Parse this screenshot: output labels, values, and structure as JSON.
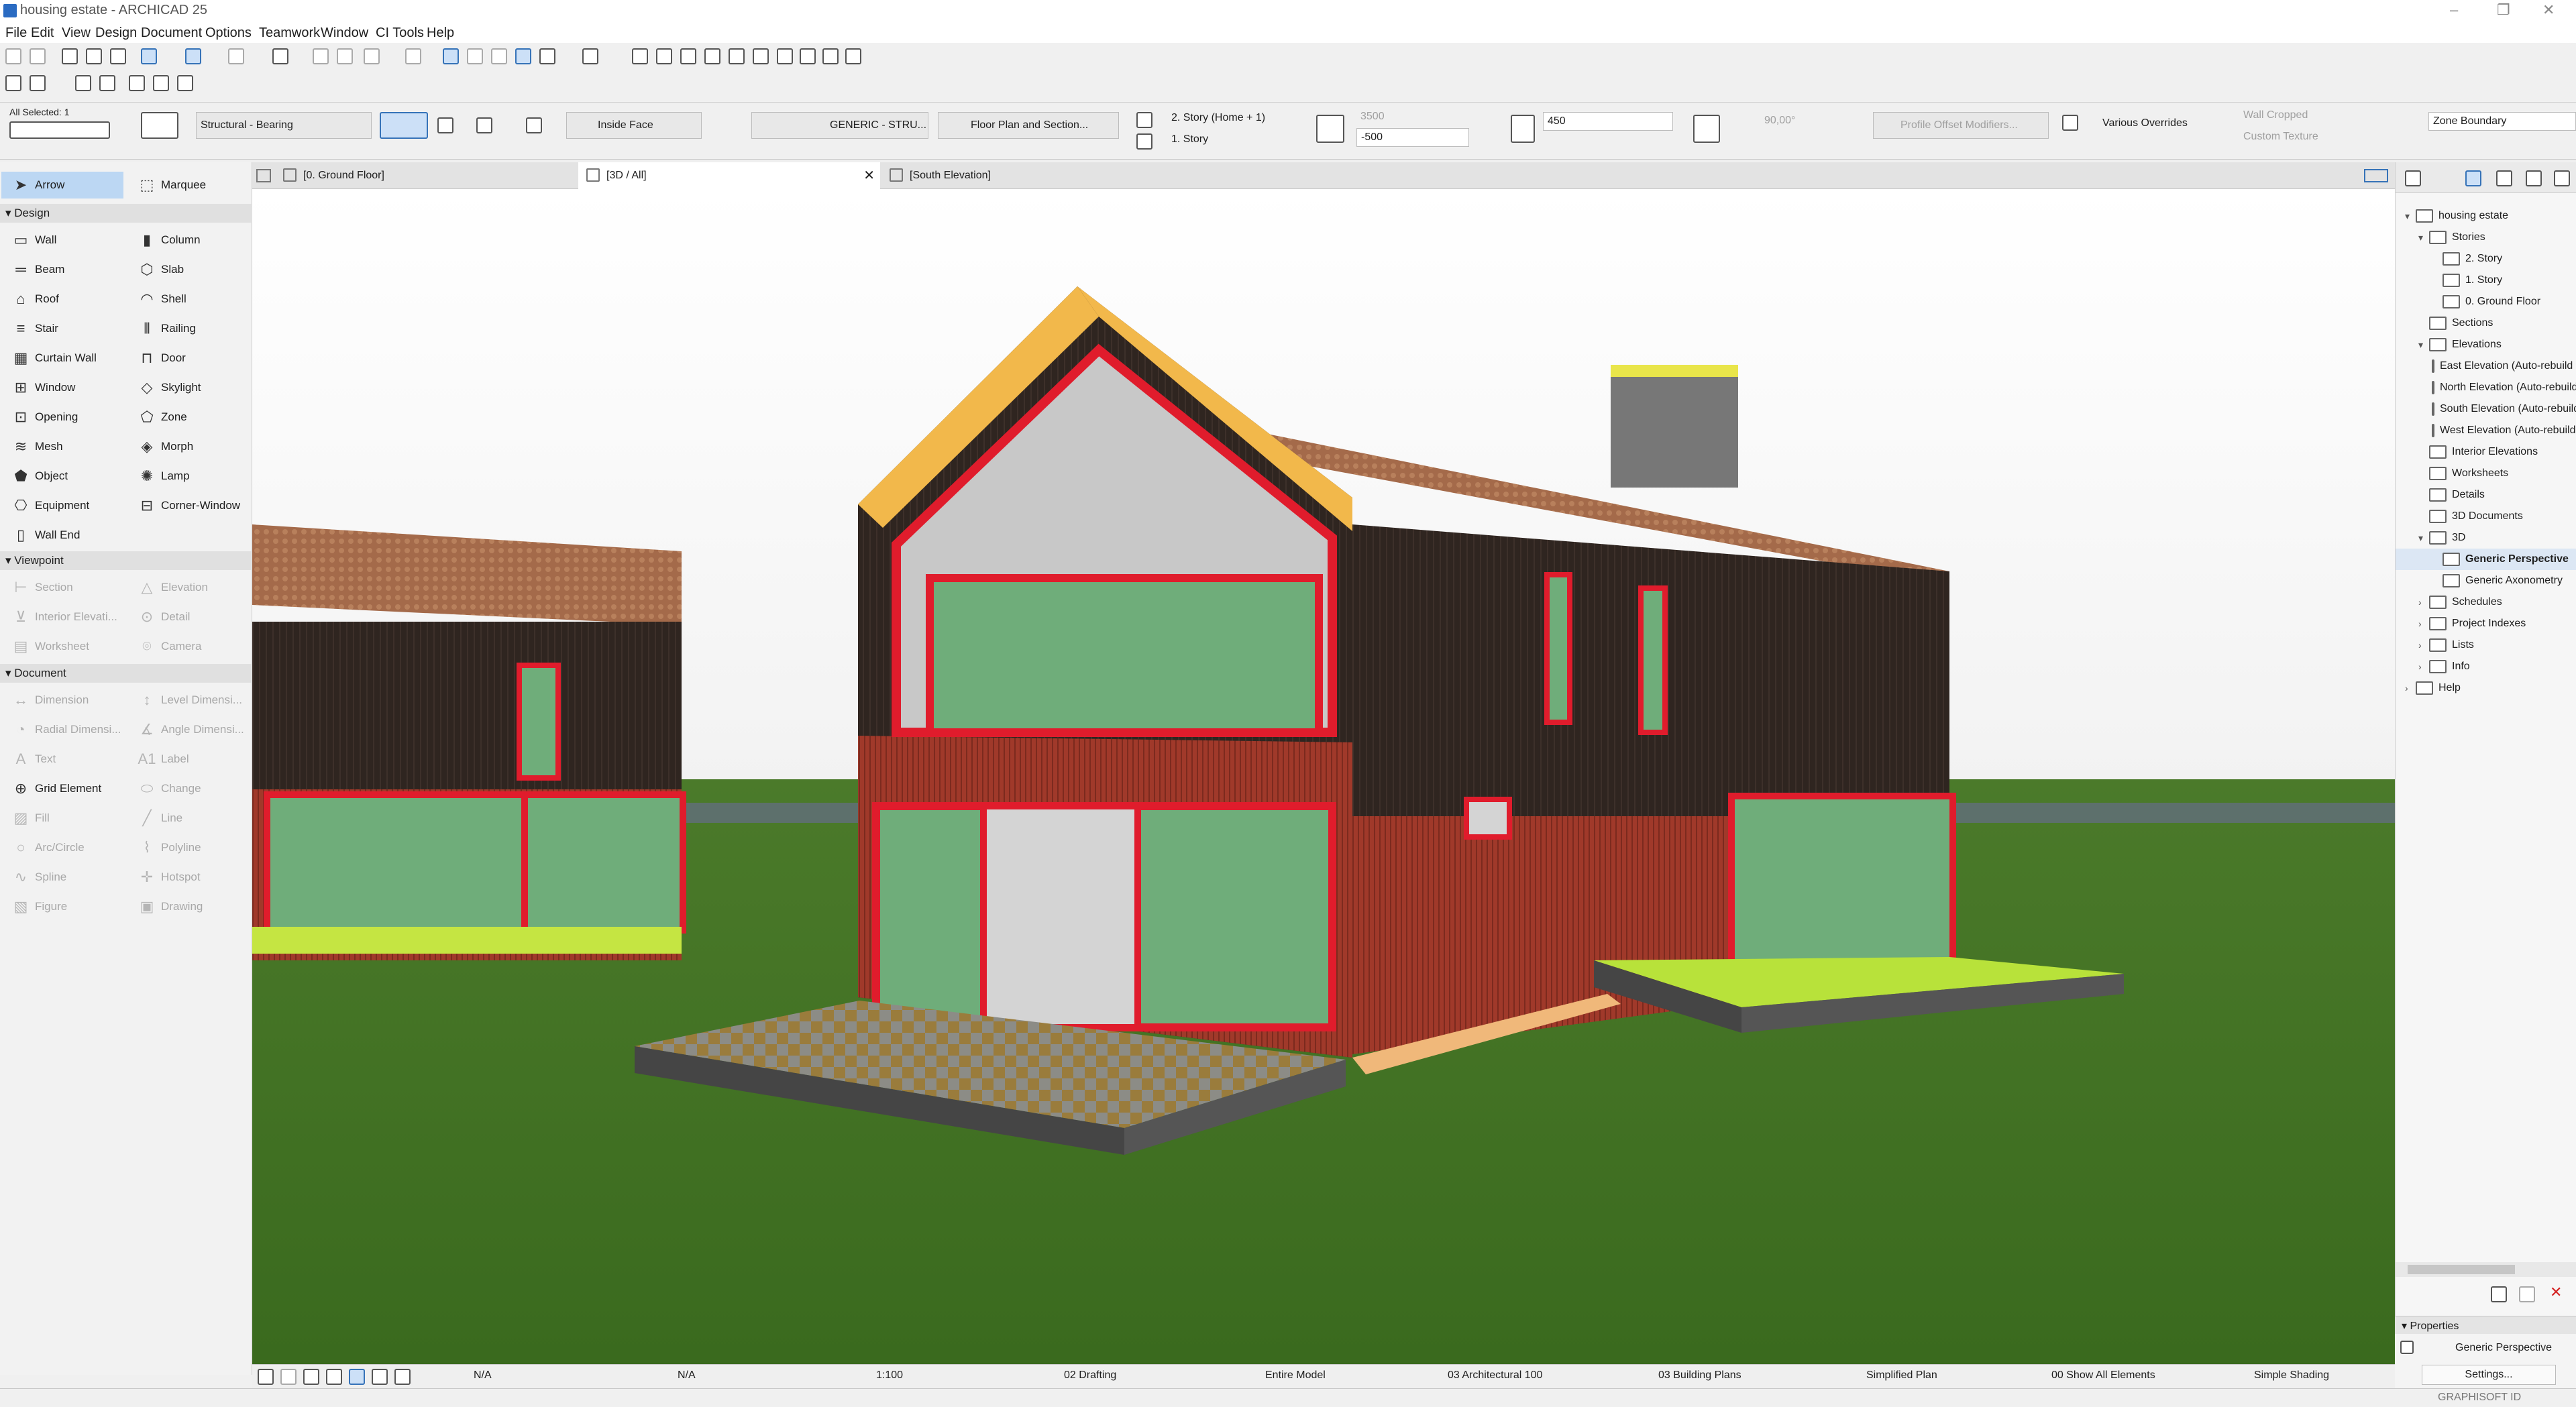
{
  "window": {
    "title": "housing estate - ARCHICAD 25"
  },
  "menu": [
    "File",
    "Edit",
    "View",
    "Design",
    "Document",
    "Options",
    "Teamwork",
    "Window",
    "CI Tools",
    "Help"
  ],
  "infobox": {
    "all_selected": "All Selected: 1",
    "structure": "Structural - Bearing",
    "reference_line": "Inside Face",
    "composite": "GENERIC - STRU...",
    "floor_plan": "Floor Plan and Section...",
    "top_story": "2. Story (Home + 1)",
    "home_story": "1. Story",
    "height": "3500",
    "offset": "-500",
    "thickness": "450",
    "slant": "90,00°",
    "profile_offset": "Profile Offset Modifiers...",
    "overrides": "Various Overrides",
    "wall_cropped": "Wall Cropped",
    "custom_texture": "Custom Texture",
    "zone_boundary": "Zone Boundary"
  },
  "toolbox": {
    "arrow": "Arrow",
    "marquee": "Marquee",
    "sections": [
      "Design",
      "Viewpoint",
      "Document"
    ],
    "design": [
      [
        "Wall",
        "Column"
      ],
      [
        "Beam",
        "Slab"
      ],
      [
        "Roof",
        "Shell"
      ],
      [
        "Stair",
        "Railing"
      ],
      [
        "Curtain Wall",
        "Door"
      ],
      [
        "Window",
        "Skylight"
      ],
      [
        "Opening",
        "Zone"
      ],
      [
        "Mesh",
        "Morph"
      ],
      [
        "Object",
        "Lamp"
      ],
      [
        "Equipment",
        "Corner-Window"
      ],
      [
        "Wall End",
        ""
      ]
    ],
    "viewpoint": [
      [
        "Section",
        "Elevation"
      ],
      [
        "Interior Elevati...",
        "Detail"
      ],
      [
        "Worksheet",
        "Camera"
      ]
    ],
    "document": [
      [
        "Dimension",
        "Level Dimensi..."
      ],
      [
        "Radial Dimensi...",
        "Angle Dimensi..."
      ],
      [
        "Text",
        "Label"
      ],
      [
        "Grid Element",
        "Change"
      ],
      [
        "Fill",
        "Line"
      ],
      [
        "Arc/Circle",
        "Polyline"
      ],
      [
        "Spline",
        "Hotspot"
      ],
      [
        "Figure",
        "Drawing"
      ]
    ]
  },
  "tabs": [
    "[0. Ground Floor]",
    "[3D / All]",
    "[South Elevation]"
  ],
  "navigator": {
    "root": "housing estate",
    "stories": "Stories",
    "story_items": [
      "2. Story",
      "1. Story",
      "0. Ground Floor"
    ],
    "sections": "Sections",
    "elevations": "Elevations",
    "elevation_items": [
      "East Elevation (Auto-rebuild Model)",
      "North Elevation (Auto-rebuild Model)",
      "South Elevation (Auto-rebuild Model)",
      "West Elevation (Auto-rebuild Model)"
    ],
    "interior": "Interior Elevations",
    "worksheets": "Worksheets",
    "details": "Details",
    "docs3d": "3D Documents",
    "node3d": "3D",
    "items3d": [
      "Generic Perspective",
      "Generic Axonometry"
    ],
    "schedules": "Schedules",
    "indexes": "Project Indexes",
    "lists": "Lists",
    "info": "Info",
    "help": "Help"
  },
  "properties": {
    "header": "Properties",
    "value": "Generic Perspective",
    "button": "Settings..."
  },
  "status": {
    "na1": "N/A",
    "na2": "N/A",
    "scale": "1:100",
    "layer": "02 Drafting",
    "model": "Entire Model",
    "pen": "03 Architectural 100",
    "mvo": "03 Building Plans",
    "renov": "Simplified Plan",
    "filter": "00 Show All Elements",
    "shading": "Simple Shading"
  },
  "brand": "GRAPHISOFT ID"
}
